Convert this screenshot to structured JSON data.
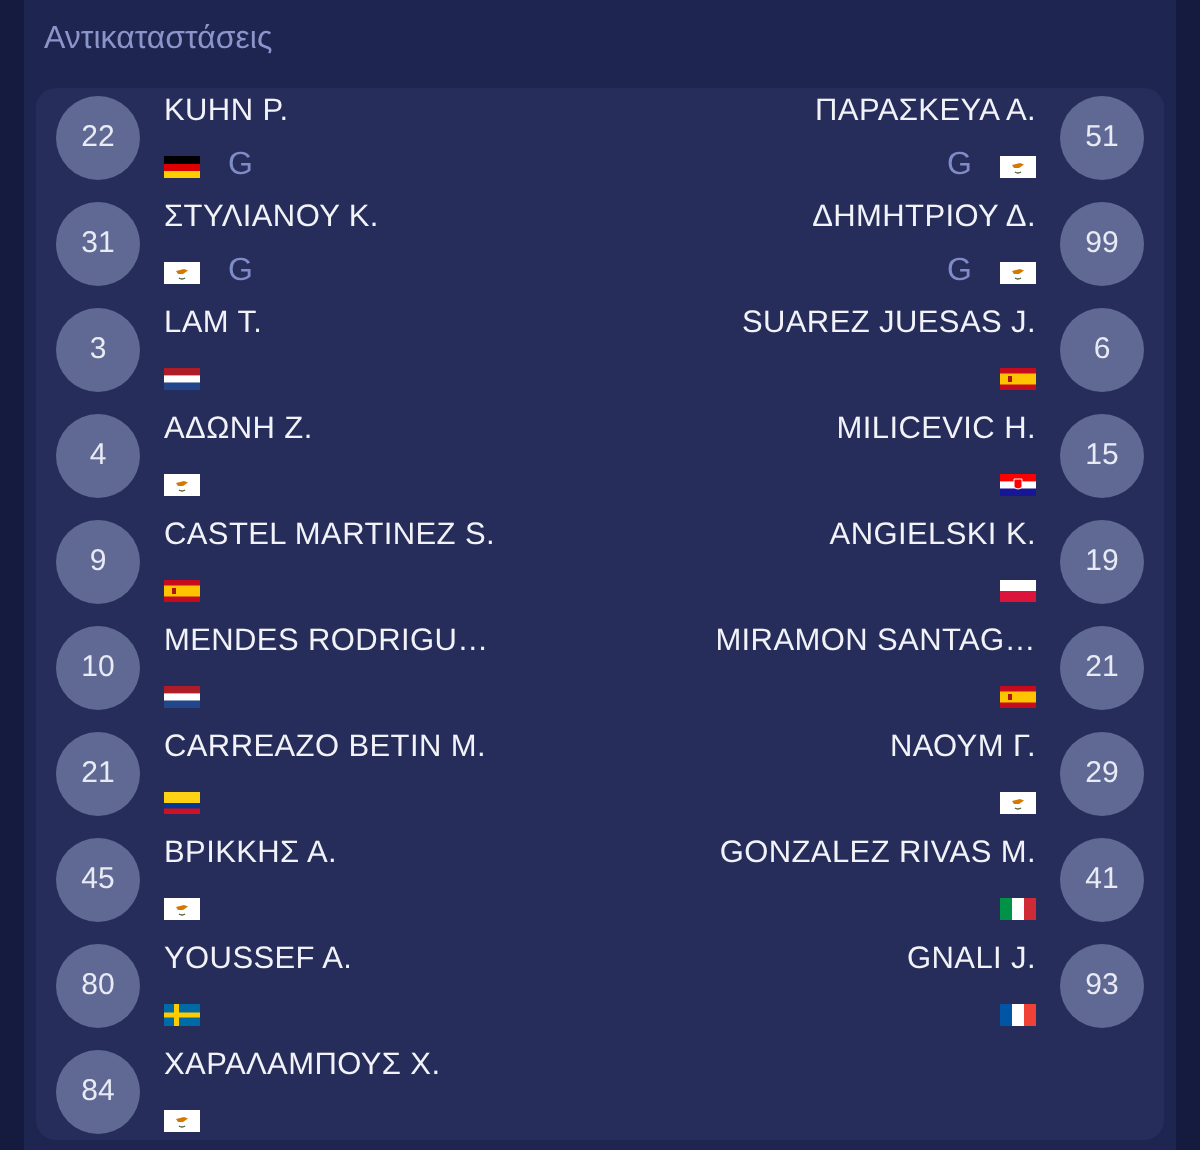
{
  "title": "Αντικαταστάσεις",
  "home": [
    {
      "number": "22",
      "name": "KUHN P.",
      "kind": "germany",
      "position": "G"
    },
    {
      "number": "31",
      "name": "ΣΤΥΛΙΑΝΟΥ Κ.",
      "kind": "cyprus",
      "position": "G"
    },
    {
      "number": "3",
      "name": "LAM T.",
      "kind": "netherlands"
    },
    {
      "number": "4",
      "name": "ΑΔΩΝΗ Ζ.",
      "kind": "cyprus"
    },
    {
      "number": "9",
      "name": "CASTEL MARTINEZ S.",
      "kind": "spain"
    },
    {
      "number": "10",
      "name": "MENDES RODRIGU…",
      "kind": "netherlands"
    },
    {
      "number": "21",
      "name": "CARREAZO BETIN M.",
      "kind": "colombia"
    },
    {
      "number": "45",
      "name": "ΒΡΙΚΚΗΣ Α.",
      "kind": "cyprus"
    },
    {
      "number": "80",
      "name": "YOUSSEF A.",
      "kind": "sweden"
    },
    {
      "number": "84",
      "name": "ΧΑΡΑΛΑΜΠΟΥΣ Χ.",
      "kind": "cyprus"
    }
  ],
  "away": [
    {
      "number": "51",
      "name": "ΠΑΡΑΣΚΕΥΑ Α.",
      "kind": "cyprus",
      "position": "G"
    },
    {
      "number": "99",
      "name": "ΔΗΜΗΤΡΙΟΥ Δ.",
      "kind": "cyprus",
      "position": "G"
    },
    {
      "number": "6",
      "name": "SUAREZ JUESAS J.",
      "kind": "spain"
    },
    {
      "number": "15",
      "name": "MILICEVIC H.",
      "kind": "croatia"
    },
    {
      "number": "19",
      "name": "ANGIELSKI K.",
      "kind": "poland"
    },
    {
      "number": "21",
      "name": "MIRAMON SANTAG…",
      "kind": "spain"
    },
    {
      "number": "29",
      "name": "ΝΑΟΥΜ Γ.",
      "kind": "cyprus"
    },
    {
      "number": "41",
      "name": "GONZALEZ RIVAS M.",
      "kind": "italy"
    },
    {
      "number": "93",
      "name": "GNALI J.",
      "kind": "france"
    }
  ]
}
